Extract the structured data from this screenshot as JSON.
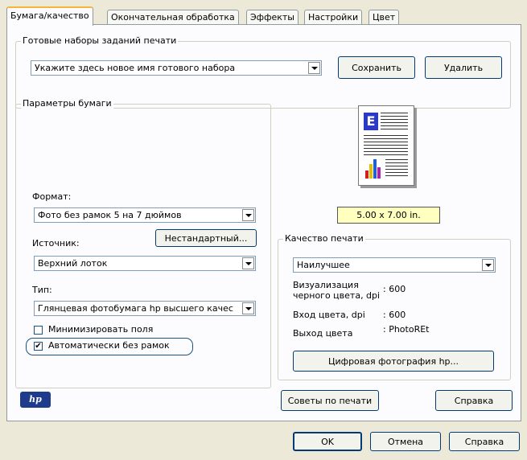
{
  "tabs": [
    "Бумага/качество",
    "Окончательная обработка",
    "Эффекты",
    "Настройки",
    "Цвет"
  ],
  "presets": {
    "legend": "Готовые наборы заданий печати",
    "combo_value": "Укажите здесь новое имя готового набора",
    "save_label": "Сохранить",
    "delete_label": "Удалить"
  },
  "paper": {
    "legend": "Параметры бумаги",
    "format_label": "Формат:",
    "format_value": "Фото без рамок 5 на 7 дюймов",
    "source_label": "Источник:",
    "custom_label": "Нестандартный...",
    "source_value": "Верхний лоток",
    "type_label": "Тип:",
    "type_value": "Глянцевая фотобумага hp высшего качес",
    "minimize_margins_label": "Минимизировать поля",
    "auto_borderless_label": "Автоматически без рамок",
    "auto_borderless_checked": "✔"
  },
  "preview": {
    "size_label": "5.00 x 7.00 in."
  },
  "quality": {
    "legend": "Качество печати",
    "value": "Наилучшее",
    "black_dpi_label_1": "Визуализация",
    "black_dpi_label_2": "черного цвета, dpi",
    "black_dpi_value": ": 600",
    "color_in_label": "Вход цвета, dpi",
    "color_in_value": ": 600",
    "color_out_label": "Выход цвета",
    "color_out_value": ": PhotoREt",
    "digital_photo_label": "Цифровая фотография hp..."
  },
  "bottom": {
    "logo_text": "hp",
    "tips_label": "Советы по печати",
    "help_label": "Справка"
  },
  "dialog": {
    "ok_label": "OK",
    "cancel_label": "Отмена",
    "help_label": "Справка"
  },
  "colors": {
    "accent": "#f6b43b",
    "border": "#003c74",
    "preview_bg": "#ffffc0",
    "logo": "#1f3c8c"
  }
}
